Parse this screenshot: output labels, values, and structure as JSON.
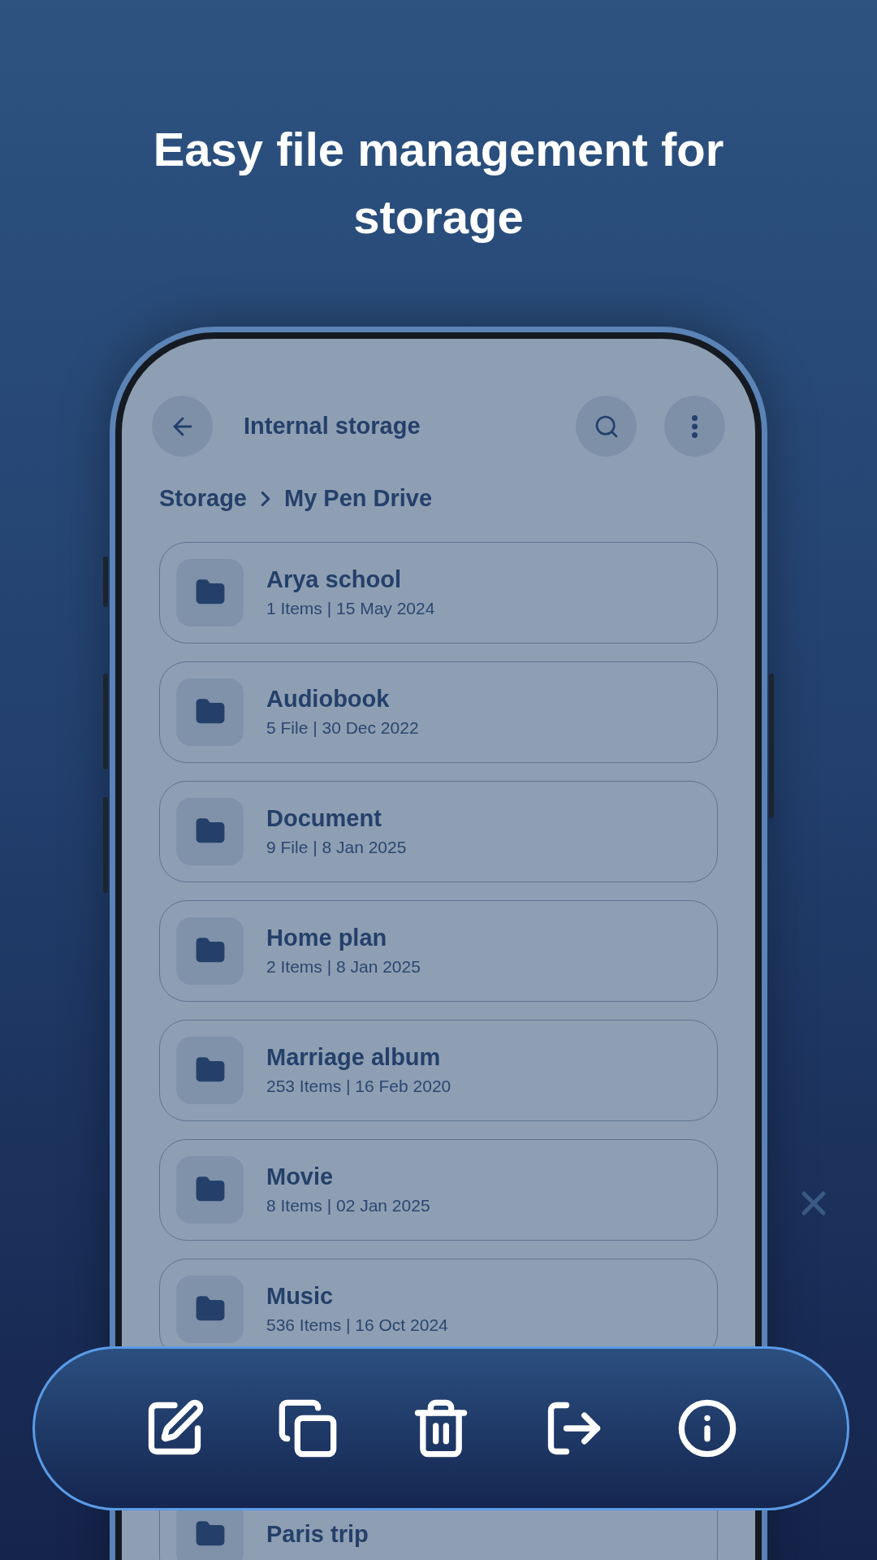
{
  "headline": "Easy file management for storage",
  "header": {
    "title": "Internal storage"
  },
  "breadcrumb": [
    "Storage",
    "My Pen Drive"
  ],
  "folders": [
    {
      "name": "Arya school",
      "meta": "1 Items | 15 May 2024"
    },
    {
      "name": "Audiobook",
      "meta": "5 File | 30 Dec 2022"
    },
    {
      "name": "Document",
      "meta": "9 File | 8 Jan 2025"
    },
    {
      "name": "Home plan",
      "meta": "2 Items | 8 Jan 2025"
    },
    {
      "name": "Marriage album",
      "meta": "253 Items | 16 Feb 2020"
    },
    {
      "name": "Movie",
      "meta": "8 Items | 02 Jan 2025"
    },
    {
      "name": "Music",
      "meta": "536 Items | 16 Oct 2024"
    },
    {
      "name": "Paris trip"
    }
  ],
  "actions": [
    {
      "kind": "edit"
    },
    {
      "kind": "copy"
    },
    {
      "kind": "delete"
    },
    {
      "kind": "move"
    },
    {
      "kind": "info"
    }
  ]
}
